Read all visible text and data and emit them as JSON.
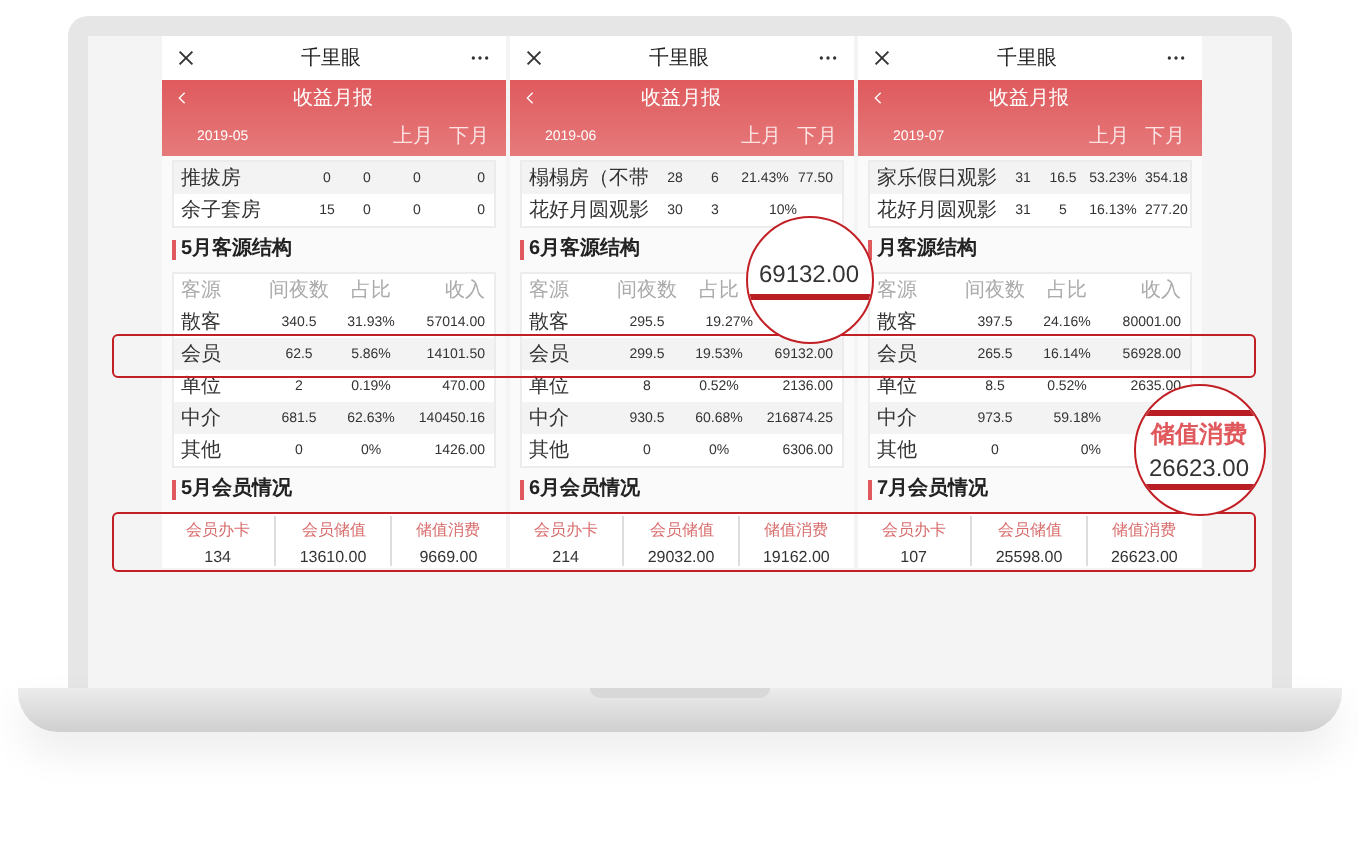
{
  "panels": [
    {
      "app_title": "千里眼",
      "report_title": "收益月报",
      "month": "2019-05",
      "prev": "上月",
      "next": "下月",
      "top_rows": [
        {
          "cells": [
            "推拔房",
            "0",
            "0",
            "0",
            "0"
          ]
        },
        {
          "cells": [
            "余子套房",
            "15",
            "0",
            "0",
            "0"
          ]
        }
      ],
      "source_section": "5月客源结构",
      "source_columns": [
        "客源",
        "间夜数",
        "占比",
        "收入"
      ],
      "source_rows": [
        {
          "cells": [
            "散客",
            "340.5",
            "31.93%",
            "57014.00"
          ]
        },
        {
          "cells": [
            "会员",
            "62.5",
            "5.86%",
            "14101.50"
          ]
        },
        {
          "cells": [
            "单位",
            "2",
            "0.19%",
            "470.00"
          ]
        },
        {
          "cells": [
            "中介",
            "681.5",
            "62.63%",
            "140450.16"
          ]
        },
        {
          "cells": [
            "其他",
            "0",
            "0%",
            "1426.00"
          ]
        }
      ],
      "member_section": "5月会员情况",
      "member_columns": [
        "会员办卡",
        "会员储值",
        "储值消费"
      ],
      "member_values": [
        "134",
        "13610.00",
        "9669.00"
      ]
    },
    {
      "app_title": "千里眼",
      "report_title": "收益月报",
      "month": "2019-06",
      "prev": "上月",
      "next": "下月",
      "top_rows": [
        {
          "cells": [
            "榻榻房（不带",
            "28",
            "6",
            "21.43%",
            "77.50"
          ]
        },
        {
          "cells": [
            "花好月圆观影",
            "30",
            "3",
            "10%"
          ]
        }
      ],
      "source_section": "6月客源结构",
      "source_columns": [
        "客源",
        "间夜数",
        "占比"
      ],
      "source_rows": [
        {
          "cells": [
            "散客",
            "295.5",
            "19.27%"
          ]
        },
        {
          "cells": [
            "会员",
            "299.5",
            "19.53%",
            "69132.00"
          ]
        },
        {
          "cells": [
            "单位",
            "8",
            "0.52%",
            "2136.00"
          ]
        },
        {
          "cells": [
            "中介",
            "930.5",
            "60.68%",
            "216874.25"
          ]
        },
        {
          "cells": [
            "其他",
            "0",
            "0%",
            "6306.00"
          ]
        }
      ],
      "member_section": "6月会员情况",
      "member_columns": [
        "会员办卡",
        "会员储值",
        "储值消费"
      ],
      "member_values": [
        "214",
        "29032.00",
        "19162.00"
      ]
    },
    {
      "app_title": "千里眼",
      "report_title": "收益月报",
      "month": "2019-07",
      "prev": "上月",
      "next": "下月",
      "top_rows": [
        {
          "cells": [
            "家乐假日观影",
            "31",
            "16.5",
            "53.23%",
            "354.18"
          ]
        },
        {
          "cells": [
            "花好月圆观影",
            "31",
            "5",
            "16.13%",
            "277.20"
          ]
        }
      ],
      "source_section": "月客源结构",
      "source_columns": [
        "客源",
        "间夜数",
        "占比",
        "收入"
      ],
      "source_rows": [
        {
          "cells": [
            "散客",
            "397.5",
            "24.16%",
            "80001.00"
          ]
        },
        {
          "cells": [
            "会员",
            "265.5",
            "16.14%",
            "56928.00"
          ]
        },
        {
          "cells": [
            "单位",
            "8.5",
            "0.52%",
            "2635.00"
          ]
        },
        {
          "cells": [
            "中介",
            "973.5",
            "59.18%"
          ]
        },
        {
          "cells": [
            "其他",
            "0",
            "0%"
          ]
        }
      ],
      "member_section": "7月会员情况",
      "member_columns": [
        "会员办卡",
        "会员储值",
        "储值消费"
      ],
      "member_values": [
        "107",
        "25598.00",
        "26623.00"
      ]
    }
  ],
  "magnifiers": [
    {
      "value": "69132.00"
    },
    {
      "label": "储值消费",
      "value": "26623.00"
    }
  ]
}
